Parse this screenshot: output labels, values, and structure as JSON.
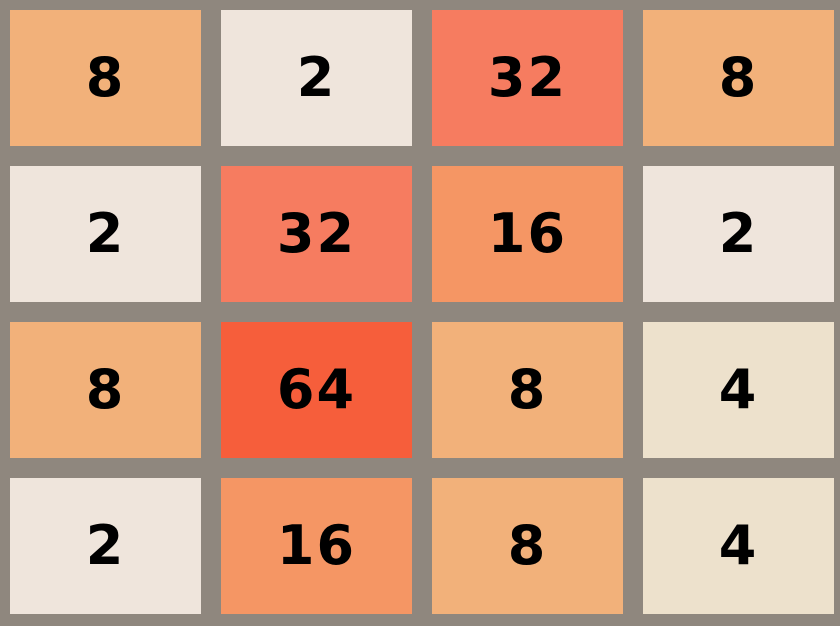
{
  "board": {
    "size": 4,
    "tiles": [
      [
        8,
        2,
        32,
        8
      ],
      [
        2,
        32,
        16,
        2
      ],
      [
        8,
        64,
        8,
        4
      ],
      [
        2,
        16,
        8,
        4
      ]
    ],
    "colors": {
      "background": "#8f877e",
      "text": "#000000",
      "tile_2": "#efe5dc",
      "tile_4": "#ede1cc",
      "tile_8": "#f2b17a",
      "tile_16": "#f59664",
      "tile_32": "#f67c60",
      "tile_64": "#f65e3b"
    }
  }
}
